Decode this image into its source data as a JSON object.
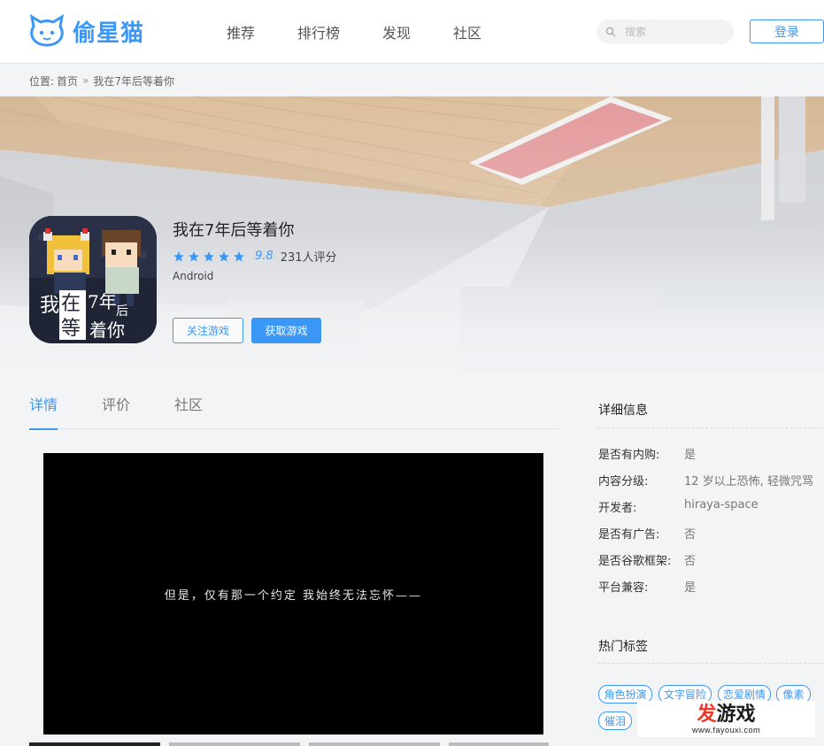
{
  "header": {
    "logo_text": "偷星猫",
    "nav": [
      "推荐",
      "排行榜",
      "发现",
      "社区"
    ],
    "search_placeholder": "搜索",
    "login_label": "登录",
    "accent": "#3a97f5"
  },
  "breadcrumb": {
    "prefix": "位置:",
    "home": "首页",
    "separator": "»",
    "current": "我在7年后等着你"
  },
  "game": {
    "title": "我在7年后等着你",
    "score": "9.8",
    "stars": 5,
    "rating_count": "231人评分",
    "platform": "Android",
    "follow_label": "关注游戏",
    "get_label": "获取游戏",
    "icon_text": [
      "我",
      "在",
      "7年",
      "后",
      "等",
      "着你"
    ]
  },
  "tabs": [
    {
      "label": "详情",
      "active": true
    },
    {
      "label": "评价",
      "active": false
    },
    {
      "label": "社区",
      "active": false
    }
  ],
  "video": {
    "caption": "但是，仅有那一个约定 我始终无法忘怀——"
  },
  "sidebar": {
    "details_title": "详细信息",
    "details": [
      {
        "label": "是否有内购:",
        "value": "是"
      },
      {
        "label": "内容分级:",
        "value": "12 岁以上恐怖, 轻微咒骂"
      },
      {
        "label": "开发者:",
        "value": "hiraya-space"
      },
      {
        "label": "是否有广告:",
        "value": "否"
      },
      {
        "label": "是否谷歌框架:",
        "value": "否"
      },
      {
        "label": "平台兼容:",
        "value": "是"
      }
    ],
    "tags_title": "热门标签",
    "tags": [
      "角色扮演",
      "文字冒险",
      "恋爱剧情",
      "像素",
      "催泪"
    ]
  },
  "watermark": {
    "title_first": "发",
    "title_rest": "游戏",
    "url": "www.fayouxi.com"
  }
}
